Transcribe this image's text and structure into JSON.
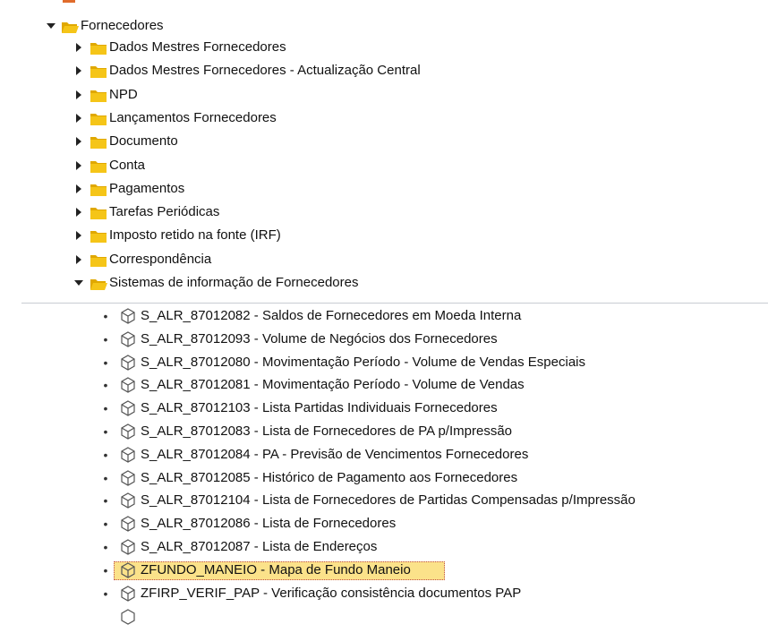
{
  "tree": {
    "root": {
      "label": "Fornecedores",
      "expanded": true
    },
    "folders": [
      {
        "label": "Dados Mestres Fornecedores",
        "expanded": false
      },
      {
        "label": "Dados Mestres Fornecedores - Actualização Central",
        "expanded": false
      },
      {
        "label": "NPD",
        "expanded": false
      },
      {
        "label": "Lançamentos Fornecedores",
        "expanded": false
      },
      {
        "label": "Documento",
        "expanded": false
      },
      {
        "label": "Conta",
        "expanded": false
      },
      {
        "label": "Pagamentos",
        "expanded": false
      },
      {
        "label": "Tarefas Periódicas",
        "expanded": false
      },
      {
        "label": "Imposto retido na fonte (IRF)",
        "expanded": false
      },
      {
        "label": "Correspondência",
        "expanded": false
      },
      {
        "label": "Sistemas de informação de Fornecedores",
        "expanded": true
      }
    ],
    "transactions": [
      {
        "code": "S_ALR_87012082",
        "desc": "Saldos de Fornecedores em Moeda Interna"
      },
      {
        "code": "S_ALR_87012093",
        "desc": "Volume de Negócios dos Fornecedores"
      },
      {
        "code": "S_ALR_87012080",
        "desc": "Movimentação Período - Volume de Vendas Especiais"
      },
      {
        "code": "S_ALR_87012081",
        "desc": "Movimentação Período - Volume de Vendas"
      },
      {
        "code": "S_ALR_87012103",
        "desc": "Lista Partidas Individuais Fornecedores"
      },
      {
        "code": "S_ALR_87012083",
        "desc": "Lista de Fornecedores de PA p/Impressão"
      },
      {
        "code": "S_ALR_87012084",
        "desc": "PA - Previsão de Vencimentos Fornecedores"
      },
      {
        "code": "S_ALR_87012085",
        "desc": "Histórico de Pagamento aos Fornecedores"
      },
      {
        "code": "S_ALR_87012104",
        "desc": "Lista de Fornecedores de Partidas Compensadas p/Impressão"
      },
      {
        "code": "S_ALR_87012086",
        "desc": "Lista de Fornecedores"
      },
      {
        "code": "S_ALR_87012087",
        "desc": "Lista de Endereços"
      },
      {
        "code": "ZFUNDO_MANEIO",
        "desc": "Mapa de Fundo Maneio",
        "selected": true
      },
      {
        "code": "ZFIRP_VERIF_PAP",
        "desc": "Verificação consistência documentos PAP"
      }
    ],
    "separator": " - "
  },
  "colors": {
    "folder": "#f5c518",
    "folder_dark": "#e0a800",
    "selection": "#fbe28a",
    "selection_border": "#c0504d",
    "icon": "#555555"
  }
}
